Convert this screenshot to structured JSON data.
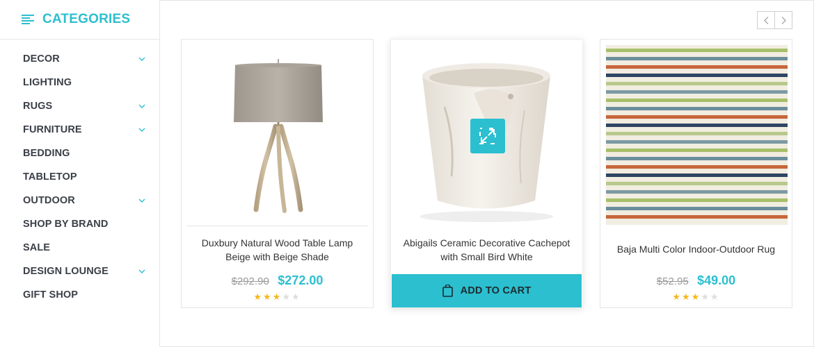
{
  "sidebar": {
    "title": "CATEGORIES",
    "items": [
      {
        "label": "DECOR",
        "has_submenu": true
      },
      {
        "label": "LIGHTING",
        "has_submenu": false
      },
      {
        "label": "RUGS",
        "has_submenu": true
      },
      {
        "label": "FURNITURE",
        "has_submenu": true
      },
      {
        "label": "BEDDING",
        "has_submenu": false
      },
      {
        "label": "TABLETOP",
        "has_submenu": false
      },
      {
        "label": "OUTDOOR",
        "has_submenu": true
      },
      {
        "label": "SHOP BY BRAND",
        "has_submenu": false
      },
      {
        "label": "SALE",
        "has_submenu": false
      },
      {
        "label": "DESIGN LOUNGE",
        "has_submenu": true
      },
      {
        "label": "GIFT SHOP",
        "has_submenu": false
      }
    ]
  },
  "carousel": {
    "prev_icon": "chevron-left-icon",
    "next_icon": "chevron-right-icon"
  },
  "products": [
    {
      "name": "Duxbury Natural Wood Table Lamp Beige with Beige Shade",
      "old_price": "$292.90",
      "price": "$272.00",
      "rating": 3,
      "rating_max": 5,
      "image": "table-lamp"
    },
    {
      "name": "Abigails Ceramic Decorative Cachepot with Small Bird White",
      "hovered": true,
      "add_to_cart_label": "ADD TO CART",
      "image": "ceramic-cachepot",
      "zoom_icon": "expand-icon"
    },
    {
      "name": "Baja Multi Color Indoor-Outdoor Rug",
      "old_price": "$52.95",
      "price": "$49.00",
      "rating": 3,
      "rating_max": 5,
      "image": "striped-rug"
    }
  ],
  "colors": {
    "accent": "#2bbfcf",
    "star_on": "#f6b71c",
    "star_off": "#dedede",
    "border": "#e5e5e5"
  }
}
